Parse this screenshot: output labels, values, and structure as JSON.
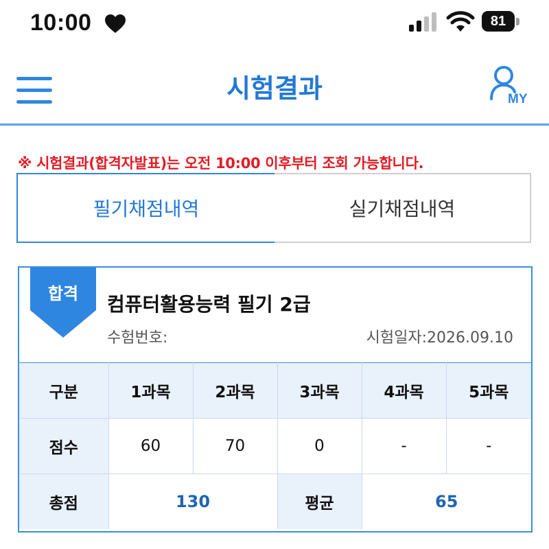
{
  "status_bar": {
    "time": "10:00",
    "battery": "81",
    "icons": [
      "heart-icon",
      "signal-icon",
      "wifi-icon",
      "battery-icon"
    ]
  },
  "header": {
    "menu_icon": "hamburger-icon",
    "title": "시험결과",
    "my_label": "MY",
    "accent_color": "#2f86e0"
  },
  "notice": {
    "prefix": "※ 시험결과(합격자발표)는 오전 ",
    "time": "10:00",
    "suffix": " 이후부터 조회 가능합니다.",
    "color": "#e31b23"
  },
  "tabs": [
    {
      "label": "필기채점내역",
      "active": true
    },
    {
      "label": "실기채점내역",
      "active": false
    }
  ],
  "result": {
    "badge": "합격",
    "exam_name": "컴퓨터활용능력 필기 2급",
    "exam_no_label": "수험번호:",
    "exam_date": "시험일자:2026.09.10",
    "table": {
      "headers": [
        "구분",
        "1과목",
        "2과목",
        "3과목",
        "4과목",
        "5과목"
      ],
      "score_label": "점수",
      "scores": [
        "60",
        "70",
        "0",
        "-",
        "-"
      ],
      "total_label": "총점",
      "total": "130",
      "avg_label": "평균",
      "avg": "65"
    }
  }
}
